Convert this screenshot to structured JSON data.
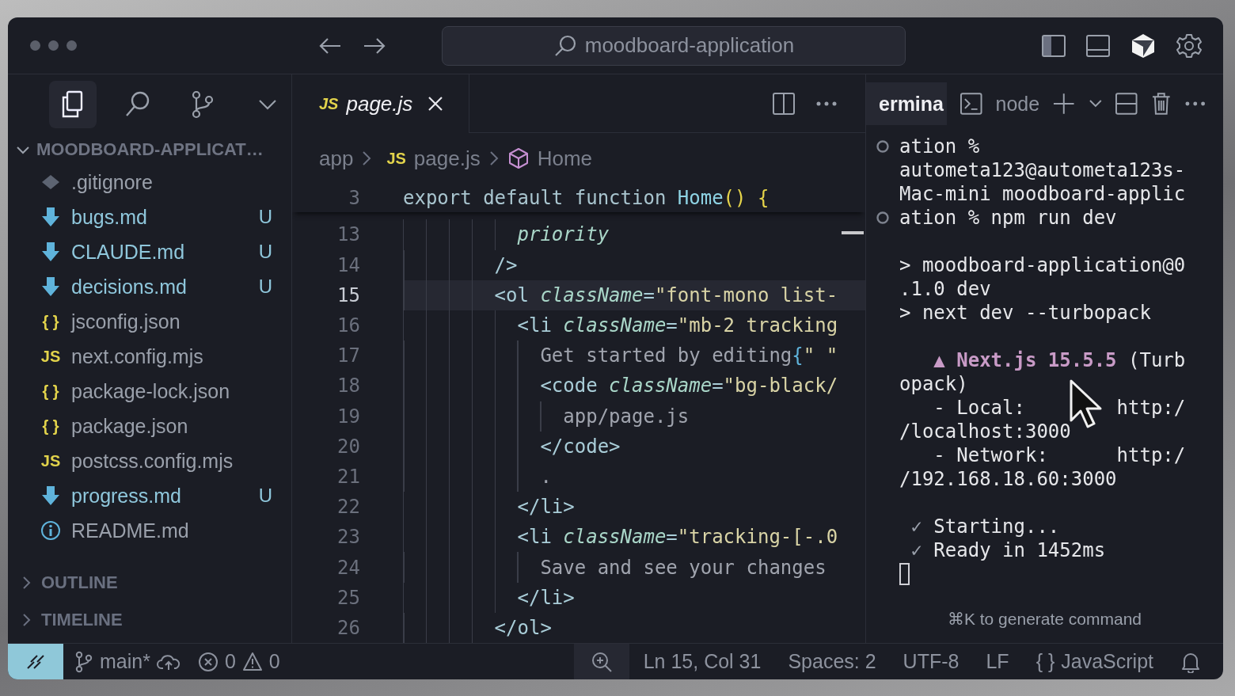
{
  "title_bar": {
    "search": {
      "value": "moodboard-application"
    }
  },
  "activity": [
    {
      "kind": "files",
      "selected": true
    },
    {
      "kind": "search",
      "selected": false
    },
    {
      "kind": "source-control",
      "selected": false
    },
    {
      "kind": "more",
      "selected": false
    }
  ],
  "explorer": {
    "title": "MOODBOARD-APPLICAT…",
    "expanded": true,
    "files": [
      {
        "name": ".gitignore",
        "kind": "git",
        "untracked": false
      },
      {
        "name": "bugs.md",
        "kind": "md",
        "untracked": true,
        "badge": "U"
      },
      {
        "name": "CLAUDE.md",
        "kind": "md",
        "untracked": true,
        "badge": "U"
      },
      {
        "name": "decisions.md",
        "kind": "md",
        "untracked": true,
        "badge": "U"
      },
      {
        "name": "jsconfig.json",
        "kind": "json",
        "icon_text": "{ }",
        "untracked": false
      },
      {
        "name": "next.config.mjs",
        "kind": "js",
        "icon_text": "JS",
        "untracked": false
      },
      {
        "name": "package-lock.json",
        "kind": "json",
        "icon_text": "{ }",
        "untracked": false
      },
      {
        "name": "package.json",
        "kind": "json",
        "icon_text": "{ }",
        "untracked": false
      },
      {
        "name": "postcss.config.mjs",
        "kind": "js",
        "icon_text": "JS",
        "untracked": false
      },
      {
        "name": "progress.md",
        "kind": "md",
        "untracked": true,
        "badge": "U"
      },
      {
        "name": "README.md",
        "kind": "info",
        "untracked": false
      }
    ]
  },
  "sections": [
    {
      "label": "OUTLINE",
      "expanded": false
    },
    {
      "label": "TIMELINE",
      "expanded": false
    }
  ],
  "editor": {
    "tabs": [
      {
        "name": "page.js",
        "icon_text": "JS",
        "selected": true
      }
    ],
    "breadcrumbs": [
      {
        "label": "app",
        "kind": "folder"
      },
      {
        "label": "page.js",
        "kind": "js",
        "icon_text": "JS"
      },
      {
        "label": "Home",
        "kind": "symbol"
      }
    ],
    "sticky": {
      "num": "3",
      "tokens": [
        {
          "t": "export default function ",
          "kind": "kw"
        },
        {
          "t": "Home",
          "kind": "fn"
        },
        {
          "t": "() {",
          "kind": "brace"
        }
      ]
    },
    "lines": [
      {
        "num": "13",
        "current": false,
        "tokens": [
          {
            "t": "          priority",
            "kind": "attr"
          }
        ]
      },
      {
        "num": "14",
        "current": false,
        "tokens": [
          {
            "t": "        />",
            "kind": "tag"
          }
        ]
      },
      {
        "num": "15",
        "current": true,
        "tokens": [
          {
            "t": "        <ol ",
            "kind": "tag"
          },
          {
            "t": "className",
            "kind": "attr"
          },
          {
            "t": "=",
            "kind": "tag"
          },
          {
            "t": "\"font-mono list-",
            "kind": "str"
          }
        ]
      },
      {
        "num": "16",
        "current": false,
        "tokens": [
          {
            "t": "          <li ",
            "kind": "tag"
          },
          {
            "t": "className",
            "kind": "attr"
          },
          {
            "t": "=",
            "kind": "tag"
          },
          {
            "t": "\"mb-2 tracking",
            "kind": "str"
          }
        ]
      },
      {
        "num": "17",
        "current": false,
        "tokens": [
          {
            "t": "            Get started by editing",
            "kind": "text"
          },
          {
            "t": "{",
            "kind": "jsx"
          },
          {
            "t": "\" \"",
            "kind": "str"
          }
        ]
      },
      {
        "num": "18",
        "current": false,
        "tokens": [
          {
            "t": "            <code ",
            "kind": "tag"
          },
          {
            "t": "className",
            "kind": "attr"
          },
          {
            "t": "=",
            "kind": "tag"
          },
          {
            "t": "\"bg-black/",
            "kind": "str"
          }
        ]
      },
      {
        "num": "19",
        "current": false,
        "tokens": [
          {
            "t": "              app/page.js",
            "kind": "text"
          }
        ]
      },
      {
        "num": "20",
        "current": false,
        "tokens": [
          {
            "t": "            </code>",
            "kind": "tag"
          }
        ]
      },
      {
        "num": "21",
        "current": false,
        "tokens": [
          {
            "t": "            .",
            "kind": "text"
          }
        ]
      },
      {
        "num": "22",
        "current": false,
        "tokens": [
          {
            "t": "          </li>",
            "kind": "tag"
          }
        ]
      },
      {
        "num": "23",
        "current": false,
        "tokens": [
          {
            "t": "          <li ",
            "kind": "tag"
          },
          {
            "t": "className",
            "kind": "attr"
          },
          {
            "t": "=",
            "kind": "tag"
          },
          {
            "t": "\"tracking-[-.0",
            "kind": "str"
          }
        ]
      },
      {
        "num": "24",
        "current": false,
        "tokens": [
          {
            "t": "            Save and see your changes",
            "kind": "text"
          }
        ]
      },
      {
        "num": "25",
        "current": false,
        "tokens": [
          {
            "t": "          </li>",
            "kind": "tag"
          }
        ]
      },
      {
        "num": "26",
        "current": false,
        "tokens": [
          {
            "t": "        </ol>",
            "kind": "tag"
          }
        ]
      }
    ]
  },
  "terminal": {
    "tab": "ermina",
    "shell": "node",
    "blocks": [
      [
        {
          "marker": true,
          "segs": [
            {
              "t": "ation %",
              "kind": "plain"
            }
          ]
        },
        {
          "marker": false,
          "segs": [
            {
              "t": "autometa123@autometa123s-",
              "kind": "plain"
            }
          ]
        },
        {
          "marker": false,
          "segs": [
            {
              "t": "Mac-mini moodboard-applic",
              "kind": "plain"
            }
          ]
        },
        {
          "marker": true,
          "segs": [
            {
              "t": "ation % npm run dev",
              "kind": "plain"
            }
          ]
        }
      ],
      [
        {
          "marker": false,
          "segs": [
            {
              "t": "> moodboard-application@0",
              "kind": "plain"
            }
          ]
        },
        {
          "marker": false,
          "segs": [
            {
              "t": ".1.0 dev",
              "kind": "plain"
            }
          ]
        },
        {
          "marker": false,
          "segs": [
            {
              "t": "> next dev --turbopack",
              "kind": "plain"
            }
          ]
        }
      ],
      [
        {
          "marker": false,
          "segs": [
            {
              "t": "   ▲ Next.js 15.5.5",
              "kind": "hl"
            },
            {
              "t": " (Turb",
              "kind": "plain"
            }
          ]
        },
        {
          "marker": false,
          "segs": [
            {
              "t": "opack)",
              "kind": "plain"
            }
          ]
        },
        {
          "marker": false,
          "segs": [
            {
              "t": "   - Local:        http:/",
              "kind": "plain"
            }
          ]
        },
        {
          "marker": false,
          "segs": [
            {
              "t": "/localhost:3000",
              "kind": "plain"
            }
          ]
        },
        {
          "marker": false,
          "segs": [
            {
              "t": "   - Network:      http:/",
              "kind": "plain"
            }
          ]
        },
        {
          "marker": false,
          "segs": [
            {
              "t": "/192.168.18.60:3000",
              "kind": "plain"
            }
          ]
        }
      ],
      [
        {
          "marker": false,
          "segs": [
            {
              "t": " ✓ ",
              "kind": "dim"
            },
            {
              "t": "Starting...",
              "kind": "plain"
            }
          ]
        },
        {
          "marker": false,
          "segs": [
            {
              "t": " ✓ ",
              "kind": "dim"
            },
            {
              "t": "Ready in 1452ms",
              "kind": "plain"
            }
          ]
        }
      ]
    ],
    "hint": "⌘K to generate command"
  },
  "status_bar": {
    "branch": "main*",
    "errors": "0",
    "warnings": "0",
    "position": "Ln 15, Col 31",
    "indent": "Spaces: 2",
    "encoding": "UTF-8",
    "eol": "LF",
    "language_icon": "{ }",
    "language": "JavaScript"
  }
}
